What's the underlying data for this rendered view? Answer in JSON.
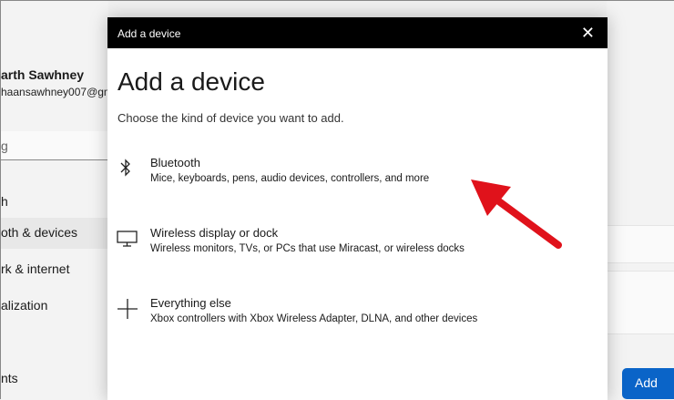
{
  "settings": {
    "user_name": "arth Sawhney",
    "user_email": "haansawhney007@gm",
    "search_placeholder": "g",
    "nav": [
      "h",
      "oth & devices",
      "rk & internet",
      "alization",
      "nts"
    ],
    "add_button": "Add"
  },
  "dialog": {
    "window_title": "Add a device",
    "heading": "Add a device",
    "subtitle": "Choose the kind of device you want to add.",
    "options": [
      {
        "title": "Bluetooth",
        "desc": "Mice, keyboards, pens, audio devices, controllers, and more",
        "icon": "bluetooth-icon"
      },
      {
        "title": "Wireless display or dock",
        "desc": "Wireless monitors, TVs, or PCs that use Miracast, or wireless docks",
        "icon": "monitor-icon"
      },
      {
        "title": "Everything else",
        "desc": "Xbox controllers with Xbox Wireless Adapter, DLNA, and other devices",
        "icon": "plus-icon"
      }
    ]
  },
  "annotation_color": "#e0121b"
}
